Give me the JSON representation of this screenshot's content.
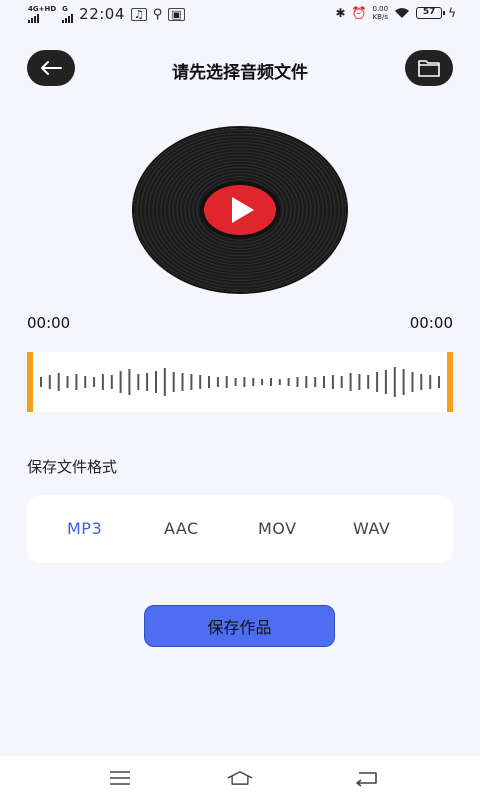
{
  "status_bar": {
    "network_1": "4G+HD",
    "network_2": "G",
    "time": "22:04",
    "speed_value": "0.00",
    "speed_unit": "KB/s",
    "battery": "57"
  },
  "header": {
    "title": "请先选择音频文件",
    "back_icon": "arrow-left-icon",
    "folder_icon": "folder-icon"
  },
  "player": {
    "record_icon": "vinyl-record-icon",
    "play_icon": "play-icon",
    "start_time": "00:00",
    "end_time": "00:00"
  },
  "waveform": {
    "handle_color": "#f3a01b",
    "bar_levels": [
      0.25,
      0.35,
      0.45,
      0.3,
      0.4,
      0.3,
      0.25,
      0.4,
      0.35,
      0.55,
      0.65,
      0.4,
      0.45,
      0.55,
      0.7,
      0.5,
      0.45,
      0.4,
      0.35,
      0.3,
      0.25,
      0.3,
      0.2,
      0.25,
      0.2,
      0.15,
      0.2,
      0.15,
      0.2,
      0.25,
      0.3,
      0.25,
      0.3,
      0.35,
      0.3,
      0.45,
      0.4,
      0.35,
      0.5,
      0.6,
      0.75,
      0.65,
      0.5,
      0.4,
      0.35,
      0.3
    ]
  },
  "format": {
    "label": "保存文件格式",
    "options": [
      "MP3",
      "AAC",
      "MOV",
      "WAV"
    ],
    "selected": "MP3",
    "selected_color": "#3f61d8"
  },
  "actions": {
    "save_label": "保存作品",
    "save_color": "#4d6ef0"
  },
  "nav_bar": {
    "menu_icon": "menu-icon",
    "home_icon": "home-icon",
    "back_icon": "return-icon"
  }
}
